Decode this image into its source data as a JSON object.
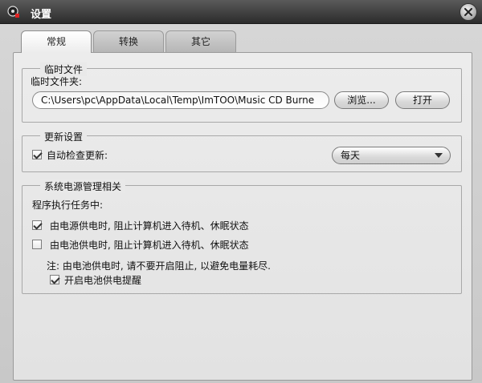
{
  "window": {
    "title": "设置",
    "app_icon": "app-logo-icon",
    "close_icon": "close-icon"
  },
  "tabs": [
    {
      "label": "常规",
      "active": true
    },
    {
      "label": "转换",
      "active": false
    },
    {
      "label": "其它",
      "active": false
    }
  ],
  "temp_files": {
    "group_title": "临时文件",
    "folder_label": "临时文件夹:",
    "folder_path": "C:\\Users\\pc\\AppData\\Local\\Temp\\ImTOO\\Music CD Burne",
    "browse_label": "浏览...",
    "open_label": "打开"
  },
  "update": {
    "group_title": "更新设置",
    "auto_check_label": "自动检查更新:",
    "auto_check_checked": true,
    "frequency_value": "每天"
  },
  "power": {
    "group_title": "系统电源管理相关",
    "subtitle": "程序执行任务中:",
    "ac_label": "由电源供电时, 阻止计算机进入待机、休眠状态",
    "ac_checked": true,
    "battery_label": "由电池供电时, 阻止计算机进入待机、休眠状态",
    "battery_checked": false,
    "note": "注: 由电池供电时, 请不要开启阻止, 以避免电量耗尽.",
    "reminder_label": "开启电池供电提醒",
    "reminder_checked": true
  },
  "colors": {
    "titlebar": "#3a3a3a",
    "panel": "#e6e6e6"
  }
}
